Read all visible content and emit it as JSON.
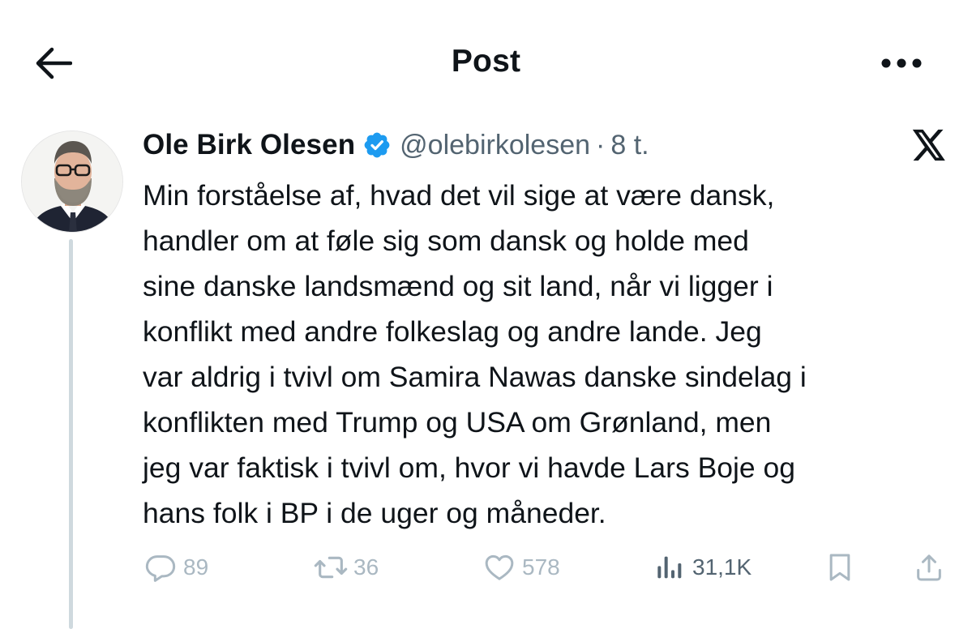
{
  "header": {
    "title": "Post"
  },
  "post": {
    "author_name": "Ole Birk Olesen",
    "handle": "@olebirkolesen",
    "separator": "·",
    "time": "8 t.",
    "lines": [
      "Min forståelse af, hvad det vil sige at være dansk,",
      "handler om at føle sig som dansk og holde med",
      "sine danske landsmænd og sit land, når vi ligger i",
      "konflikt med andre folkeslag og andre lande. Jeg",
      "var aldrig i tvivl om Samira Nawas danske sindelag i",
      "konflikten med Trump og USA om Grønland, men",
      "jeg var faktisk i tvivl om, hvor vi havde Lars Boje og",
      "hans folk i BP i de uger og måneder."
    ]
  },
  "actions": {
    "replies": "89",
    "reposts": "36",
    "likes": "578",
    "views": "31,1K"
  },
  "icons": {
    "back": "arrow-left-icon",
    "more": "more-horizontal-icon",
    "verified": "verified-badge-icon",
    "brand": "x-logo-icon",
    "reply": "reply-icon",
    "repost": "repost-icon",
    "like": "heart-icon",
    "views": "views-icon",
    "bookmark": "bookmark-icon",
    "share": "share-icon"
  },
  "colors": {
    "text": "#0f1419",
    "secondary": "#536471",
    "muted_action": "#aab8c2",
    "verified": "#1d9bf0",
    "thread_line": "#cfd9de"
  }
}
